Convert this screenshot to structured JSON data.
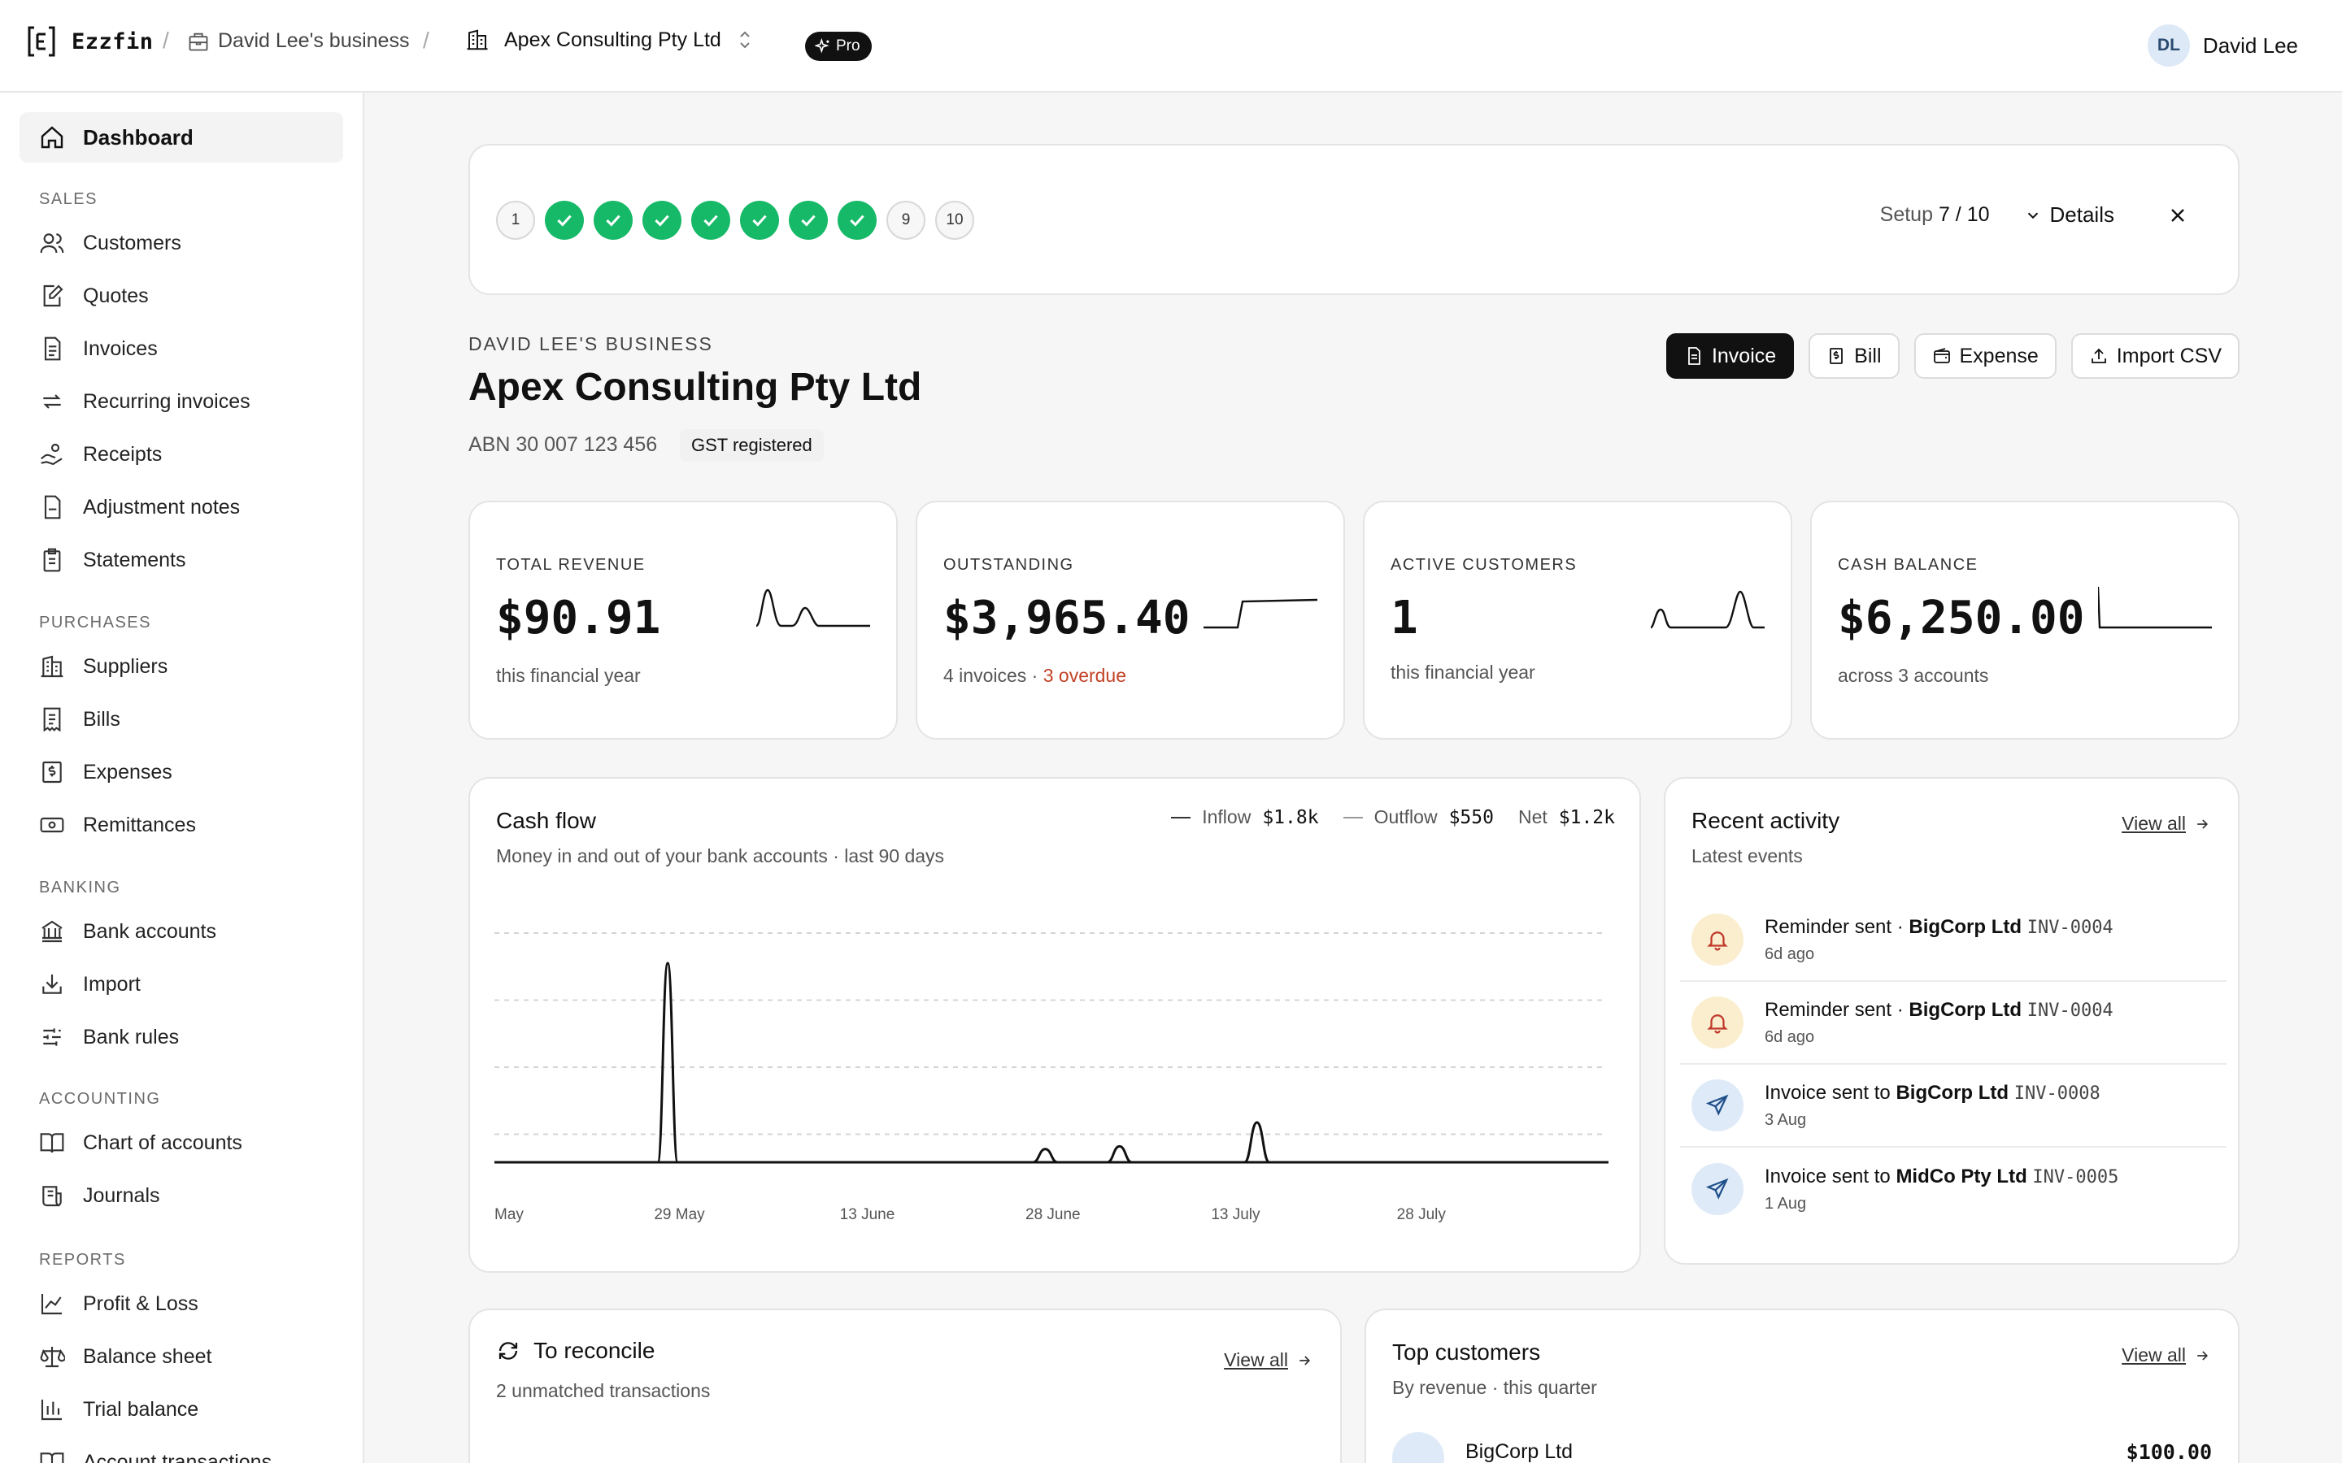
{
  "app": {
    "name": "Ezzfin"
  },
  "breadcrumb": {
    "business": "David Lee's business",
    "org": "Apex Consulting Pty Ltd",
    "plan": "Pro"
  },
  "user": {
    "initials": "DL",
    "name": "David Lee"
  },
  "sidebar": {
    "dashboard": "Dashboard",
    "sections": [
      {
        "title": "SALES",
        "items": [
          "Customers",
          "Quotes",
          "Invoices",
          "Recurring invoices",
          "Receipts",
          "Adjustment notes",
          "Statements"
        ]
      },
      {
        "title": "PURCHASES",
        "items": [
          "Suppliers",
          "Bills",
          "Expenses",
          "Remittances"
        ]
      },
      {
        "title": "BANKING",
        "items": [
          "Bank accounts",
          "Import",
          "Bank rules"
        ]
      },
      {
        "title": "ACCOUNTING",
        "items": [
          "Chart of accounts",
          "Journals"
        ]
      },
      {
        "title": "REPORTS",
        "items": [
          "Profit & Loss",
          "Balance sheet",
          "Trial balance",
          "Account transactions"
        ]
      }
    ]
  },
  "setup": {
    "steps": [
      {
        "label": "1",
        "done": false
      },
      {
        "label": "2",
        "done": true
      },
      {
        "label": "3",
        "done": true
      },
      {
        "label": "4",
        "done": true
      },
      {
        "label": "5",
        "done": true
      },
      {
        "label": "6",
        "done": true
      },
      {
        "label": "7",
        "done": true
      },
      {
        "label": "8",
        "done": true
      },
      {
        "label": "9",
        "done": false
      },
      {
        "label": "10",
        "done": false
      }
    ],
    "progress_prefix": "Setup",
    "progress_value": "7 / 10",
    "details_label": "Details"
  },
  "business": {
    "eyebrow": "DAVID LEE'S BUSINESS",
    "name": "Apex Consulting Pty Ltd",
    "abn": "ABN 30 007 123 456",
    "gst": "GST registered"
  },
  "actions": {
    "invoice": "Invoice",
    "bill": "Bill",
    "expense": "Expense",
    "import_csv": "Import CSV"
  },
  "stats": [
    {
      "label": "TOTAL REVENUE",
      "value": "$90.91",
      "sub": "this financial year"
    },
    {
      "label": "OUTSTANDING",
      "value": "$3,965.40",
      "sub": "4 invoices · ",
      "sub_alert": "3 overdue"
    },
    {
      "label": "ACTIVE CUSTOMERS",
      "value": "1",
      "sub": "this financial year"
    },
    {
      "label": "CASH BALANCE",
      "value": "$6,250.00",
      "sub": "across 3 accounts"
    }
  ],
  "cashflow": {
    "title": "Cash flow",
    "subtitle": "Money in and out of your bank accounts · last 90 days",
    "legend": {
      "inflow_label": "Inflow",
      "inflow_value": "$1.8k",
      "outflow_label": "Outflow",
      "outflow_value": "$550",
      "net_label": "Net",
      "net_value": "$1.2k"
    }
  },
  "chart_data": {
    "type": "line",
    "title": "Cash flow",
    "x_tick_labels": [
      "May",
      "29 May",
      "13 June",
      "28 June",
      "13 July",
      "28 July"
    ],
    "x_tick_days": [
      0,
      15,
      30,
      45,
      60,
      75
    ],
    "x_range_days": [
      0,
      90
    ],
    "ylim": [
      0,
      1800
    ],
    "grid": true,
    "series": [
      {
        "name": "Inflow",
        "points": [
          [
            0,
            0
          ],
          [
            13.2,
            0
          ],
          [
            14.0,
            1500
          ],
          [
            14.8,
            0
          ],
          [
            43.5,
            0
          ],
          [
            44.5,
            100
          ],
          [
            45.5,
            0
          ],
          [
            49.5,
            0
          ],
          [
            50.5,
            120
          ],
          [
            51.5,
            0
          ],
          [
            60.6,
            0
          ],
          [
            61.6,
            300
          ],
          [
            62.6,
            0
          ],
          [
            90,
            0
          ]
        ]
      }
    ]
  },
  "activity": {
    "title": "Recent activity",
    "subtitle": "Latest events",
    "view_all": "View all",
    "items": [
      {
        "type": "reminder",
        "prefix": "Reminder sent · ",
        "name": "BigCorp Ltd",
        "ref": "INV-0004",
        "time": "6d ago"
      },
      {
        "type": "reminder",
        "prefix": "Reminder sent · ",
        "name": "BigCorp Ltd",
        "ref": "INV-0004",
        "time": "6d ago"
      },
      {
        "type": "sent",
        "prefix": "Invoice sent to ",
        "name": "BigCorp Ltd",
        "ref": "INV-0008",
        "time": "3 Aug"
      },
      {
        "type": "sent",
        "prefix": "Invoice sent to ",
        "name": "MidCo Pty Ltd",
        "ref": "INV-0005",
        "time": "1 Aug"
      }
    ]
  },
  "reconcile": {
    "title": "To reconcile",
    "subtitle": "2 unmatched transactions",
    "view_all": "View all"
  },
  "top_customers": {
    "title": "Top customers",
    "subtitle": "By revenue · this quarter",
    "view_all": "View all",
    "first_name": "BigCorp Ltd",
    "first_value": "$100.00"
  },
  "colors": {
    "accent": "#111111",
    "success": "#16b968",
    "alert": "#c24125",
    "warn_bg": "#fbeecf",
    "info_bg": "#dfeaf8"
  }
}
